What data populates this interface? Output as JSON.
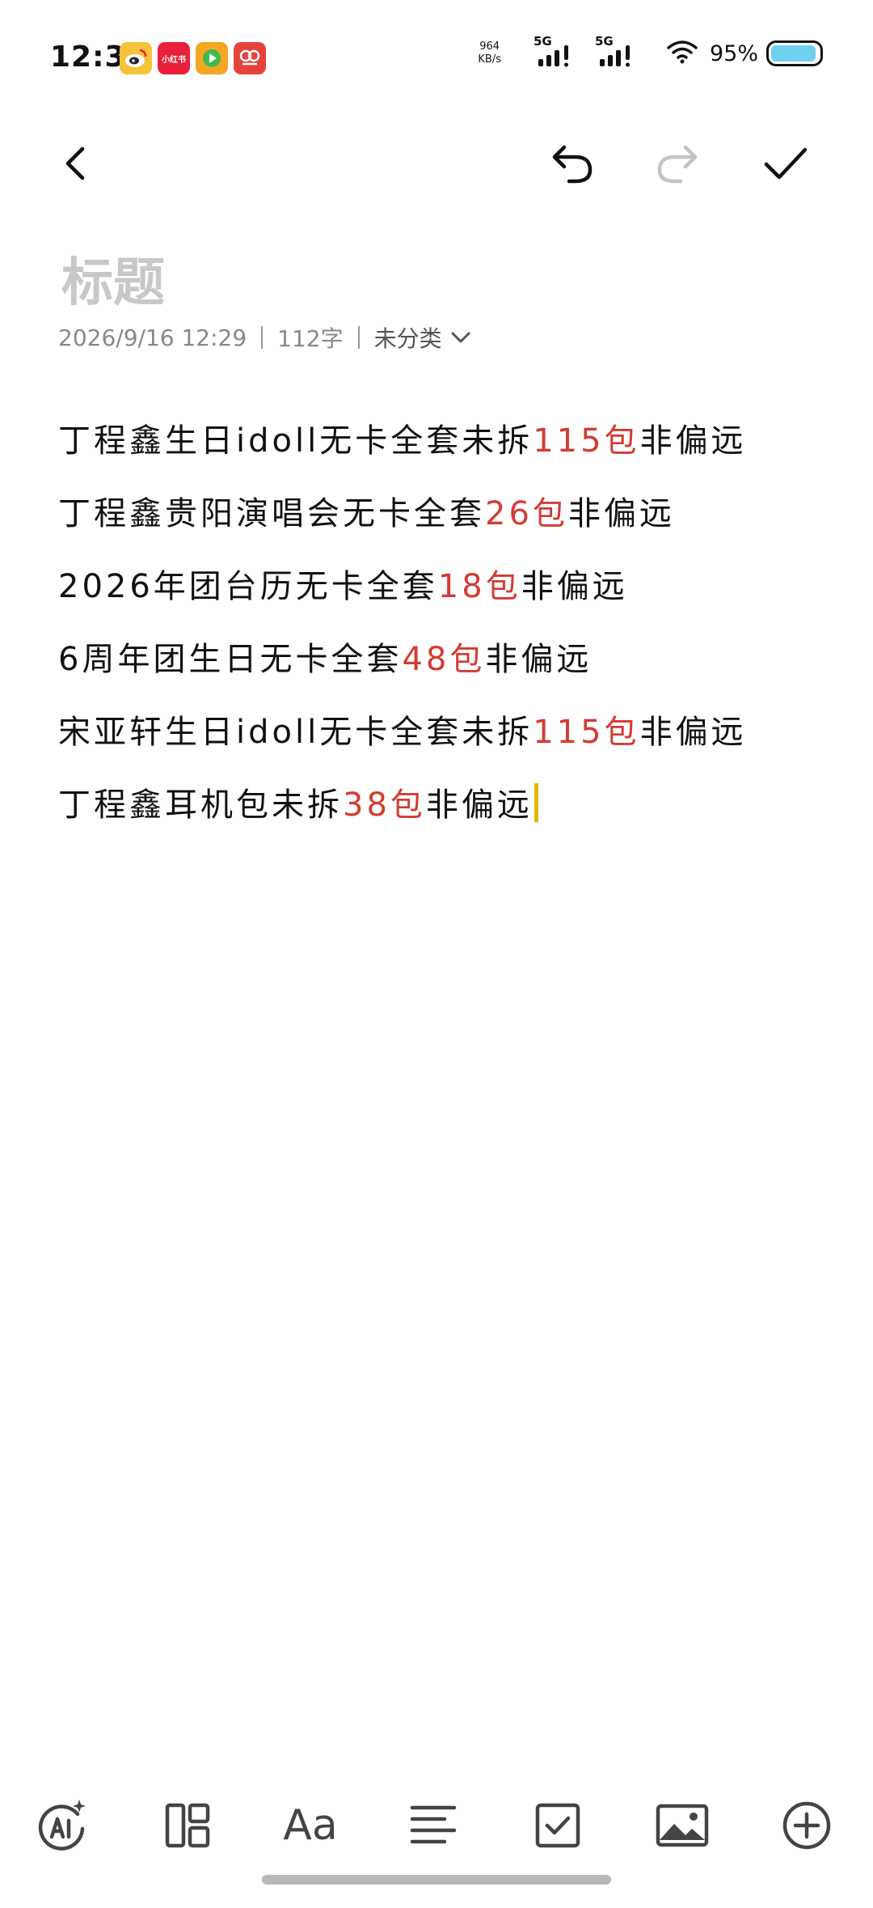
{
  "status_bar": {
    "time": "12:39",
    "apps": [
      {
        "name": "weibo-icon",
        "label": ""
      },
      {
        "name": "xiaohongshu-icon",
        "label": "小红书"
      },
      {
        "name": "video-app-icon",
        "label": ""
      },
      {
        "name": "taobao-icon",
        "label": ""
      }
    ],
    "net_speed_value": "964",
    "net_speed_unit": "KB/s",
    "sim1_label": "5G",
    "sim2_label": "5G",
    "battery_percent": "95%",
    "battery_level": 0.95,
    "battery_color": "#6fd0ef"
  },
  "toolbar": {
    "back_icon": "chevron-left-icon",
    "undo_icon": "undo-icon",
    "redo_icon": "redo-icon",
    "done_icon": "check-icon"
  },
  "note": {
    "title_placeholder": "标题",
    "meta": {
      "datetime": "2026/9/16 12:29",
      "word_count": "112字",
      "category": "未分类"
    },
    "lines": [
      {
        "before": "丁程鑫生日idoll无卡全套未拆",
        "price": "115包",
        "after": "非偏远"
      },
      {
        "before": "丁程鑫贵阳演唱会无卡全套",
        "price": "26包",
        "after": "非偏远"
      },
      {
        "before": "2026年团台历无卡全套",
        "price": "18包",
        "after": "非偏远"
      },
      {
        "before": "6周年团生日无卡全套",
        "price": "48包",
        "after": "非偏远"
      },
      {
        "before": "宋亚轩生日idoll无卡全套未拆",
        "price": "115包",
        "after": "非偏远"
      },
      {
        "before": "丁程鑫耳机包未拆",
        "price": "38包",
        "after": "非偏远"
      }
    ],
    "price_color": "#d33b33",
    "caret_color": "#e0b800"
  },
  "bottom_toolbar": {
    "ai_icon": "ai-sparkle-icon",
    "ai_label": "AI",
    "layout_icon": "layout-icon",
    "font_label": "Aa",
    "align_icon": "align-left-icon",
    "checkbox_icon": "checkbox-icon",
    "image_icon": "image-icon",
    "add_icon": "plus-circle-icon"
  }
}
